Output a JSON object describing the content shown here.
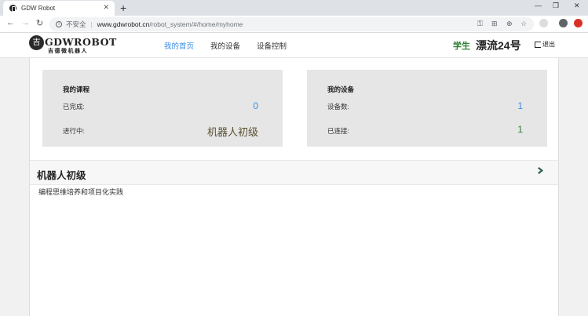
{
  "browser": {
    "tab_title": "GDW Robot",
    "new_tab": "+",
    "security_label": "不安全",
    "url_host": "www.gdwrobot.cn",
    "url_path": "/robot_system/#/home/myhome",
    "window_controls": [
      "—",
      "❐",
      "✕"
    ]
  },
  "site": {
    "logo": {
      "mark": "吉",
      "en": "GDWROBOT",
      "cn": "吉德微机器人"
    },
    "nav": [
      {
        "label": "我的首页",
        "active": true
      },
      {
        "label": "我的设备",
        "active": false
      },
      {
        "label": "设备控制",
        "active": false
      }
    ],
    "user": {
      "role": "学生",
      "name": "漂流24号",
      "logout": "退出"
    }
  },
  "courses_card": {
    "title": "我的课程",
    "rows": [
      {
        "label": "已完成:",
        "value": "0"
      },
      {
        "label": "进行中:",
        "value": "机器人初级"
      }
    ]
  },
  "devices_card": {
    "title": "我的设备",
    "rows": [
      {
        "label": "设备数:",
        "value": "1"
      },
      {
        "label": "已连接:",
        "value": "1"
      }
    ]
  },
  "course": {
    "title": "机器人初级",
    "description": "编程思维培养和项目化实践"
  },
  "colors": {
    "accent": "#3a8ee6",
    "green": "#2e7d32",
    "card_bg": "#e6e6e6"
  }
}
